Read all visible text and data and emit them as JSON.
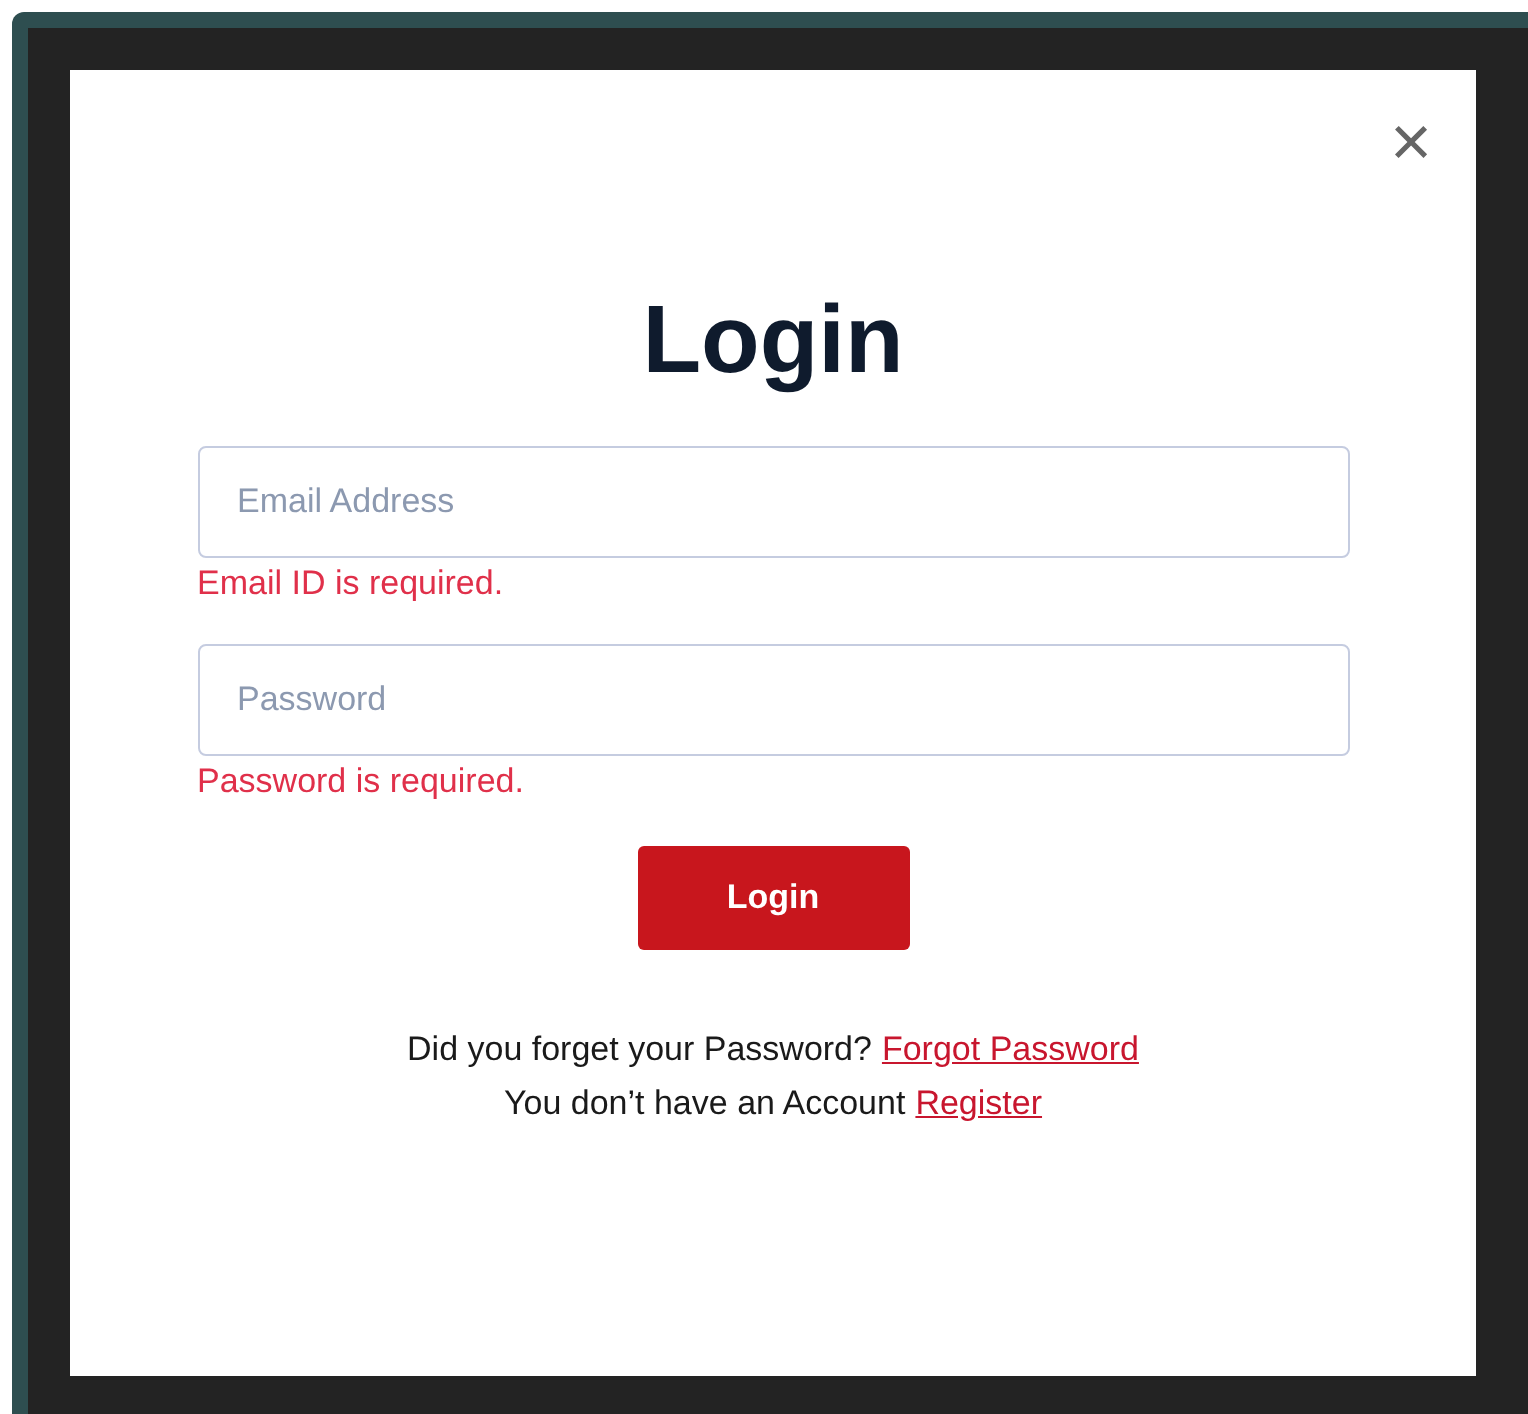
{
  "dialog": {
    "title": "Login",
    "close": "×",
    "fields": [
      {
        "placeholder": "Email Address",
        "error": "Email ID is required."
      },
      {
        "placeholder": "Password",
        "error": "Password is required."
      }
    ],
    "submit": "Login",
    "links": [
      {
        "text": "Did you forget your Password?",
        "link": "Forgot Password"
      },
      {
        "text": "You don’t have an Account",
        "link": "Register"
      }
    ]
  }
}
